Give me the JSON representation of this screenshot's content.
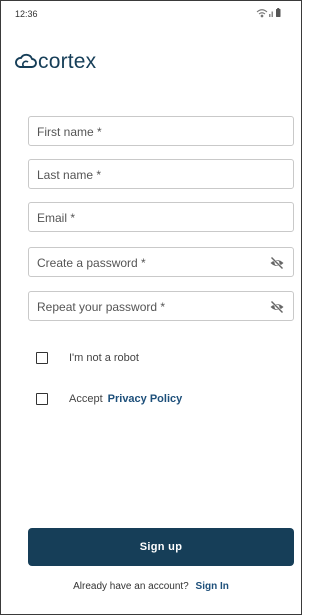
{
  "status_bar": {
    "time": "12:36",
    "icons": [
      "wifi-icon",
      "signal-icon",
      "battery-icon"
    ]
  },
  "brand": {
    "name": "cortex",
    "logo_icon": "cloud-icon",
    "color": "#163e58"
  },
  "form": {
    "first_name": {
      "label": "First name *"
    },
    "last_name": {
      "label": "Last name *"
    },
    "email": {
      "label": "Email *"
    },
    "password": {
      "label": "Create a password *",
      "icon": "eye-off-icon"
    },
    "repeat_password": {
      "label": "Repeat your password *",
      "icon": "eye-off-icon"
    }
  },
  "checks": {
    "robot": {
      "label": "I'm not a robot",
      "checked": false
    },
    "policy": {
      "label": "Accept",
      "link": "Privacy Policy",
      "checked": false
    }
  },
  "actions": {
    "signup_label": "Sign up",
    "signin_prompt": "Already have an account?",
    "signin_link": "Sign In"
  },
  "colors": {
    "primary": "#163e58",
    "link": "#1d4f7a",
    "border": "#c9c9c9"
  }
}
